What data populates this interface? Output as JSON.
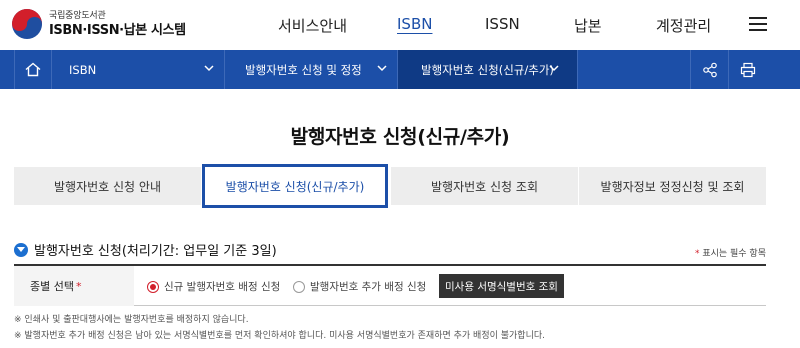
{
  "logo": {
    "org_name": "국립중앙도서관",
    "system_name": "ISBN·ISSN·납본 시스템"
  },
  "gnb": {
    "items": [
      {
        "label": "서비스안내",
        "active": false
      },
      {
        "label": "ISBN",
        "active": true
      },
      {
        "label": "ISSN",
        "active": false
      },
      {
        "label": "납본",
        "active": false
      },
      {
        "label": "계정관리",
        "active": false
      }
    ],
    "menu_icon": "hamburger-icon"
  },
  "navbar": {
    "home_icon": "home-icon",
    "segments": [
      {
        "label": "ISBN"
      },
      {
        "label": "발행자번호 신청 및 정정"
      },
      {
        "label": "발행자번호 신청(신규/추가)"
      }
    ],
    "tools": [
      "share-icon",
      "print-icon"
    ]
  },
  "page_title": "발행자번호 신청(신규/추가)",
  "tabs": [
    {
      "label": "발행자번호 신청 안내",
      "active": false
    },
    {
      "label": "발행자번호 신청(신규/추가)",
      "active": true
    },
    {
      "label": "발행자번호 신청 조회",
      "active": false
    },
    {
      "label": "발행자정보 정정신청 및 조회",
      "active": false
    }
  ],
  "section": {
    "title": "발행자번호 신청(처리기간: 업무일 기준 3일)",
    "required_star": "*",
    "required_note": "표시는 필수 항목"
  },
  "form": {
    "type_label": "종별 선택",
    "required_star": "*",
    "options": [
      {
        "label": "신규 발행자번호 배정 신청",
        "checked": true
      },
      {
        "label": "발행자번호 추가 배정 신청",
        "checked": false
      }
    ],
    "lookup_button": "미사용 서명식별번호 조회"
  },
  "notes": [
    "※ 인쇄사 및 출판대행사에는 발행자번호를 배정하지 않습니다.",
    "※ 발행자번호 추가 배정 신청은 남아 있는 서명식별번호를 먼저 확인하셔야 합니다. 미사용 서명식별번호가 존재하면 추가 배정이 불가합니다."
  ],
  "colors": {
    "brand_blue": "#1c4fa8",
    "nav_active": "#0f3a85",
    "required_red": "#d21f2b"
  }
}
